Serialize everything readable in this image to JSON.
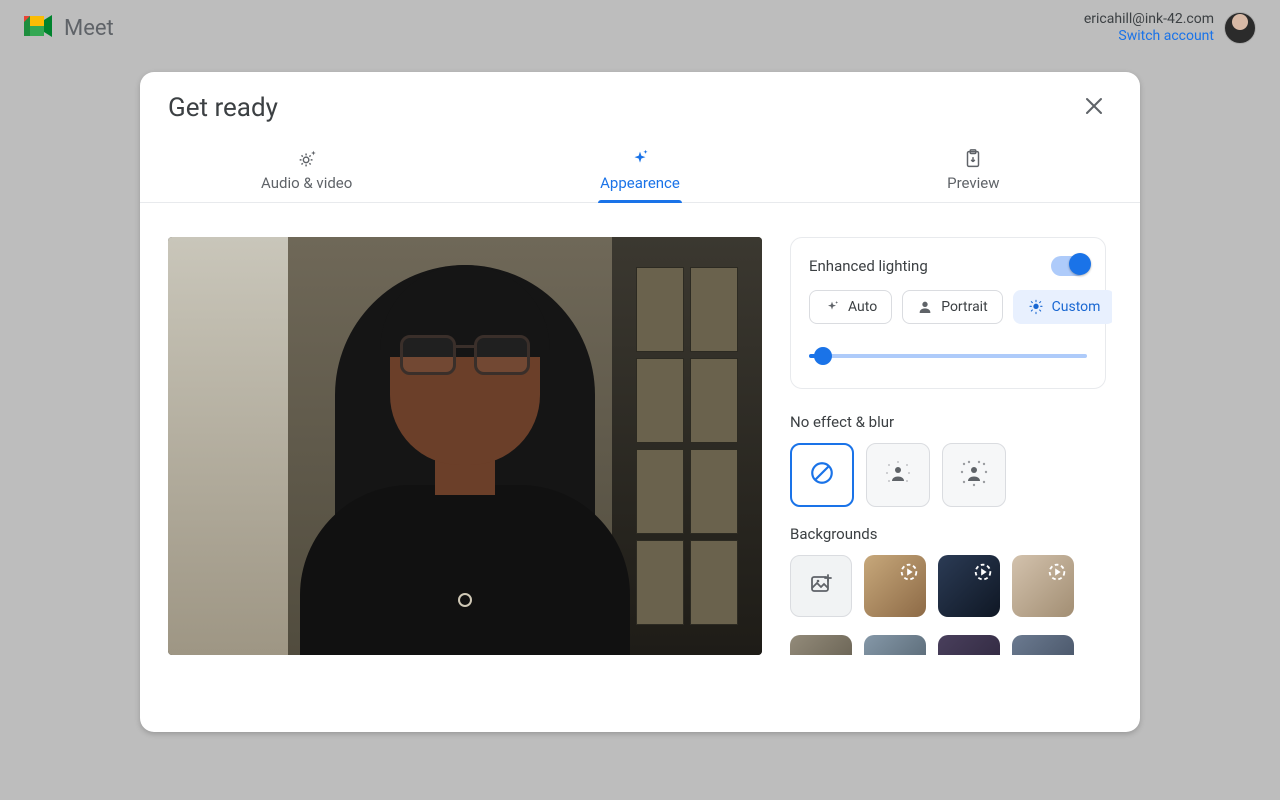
{
  "brand": "Meet",
  "account": {
    "email": "ericahill@ink-42.com",
    "switch": "Switch account"
  },
  "dialog": {
    "title": "Get ready",
    "tabs": [
      {
        "label": "Audio & video",
        "active": false
      },
      {
        "label": "Appearence",
        "active": true
      },
      {
        "label": "Preview",
        "active": false
      }
    ]
  },
  "lighting": {
    "title": "Enhanced lighting",
    "options": {
      "auto": "Auto",
      "portrait": "Portrait",
      "custom": "Custom"
    }
  },
  "effects": {
    "title": "No effect & blur"
  },
  "backgrounds": {
    "title": "Backgrounds"
  }
}
